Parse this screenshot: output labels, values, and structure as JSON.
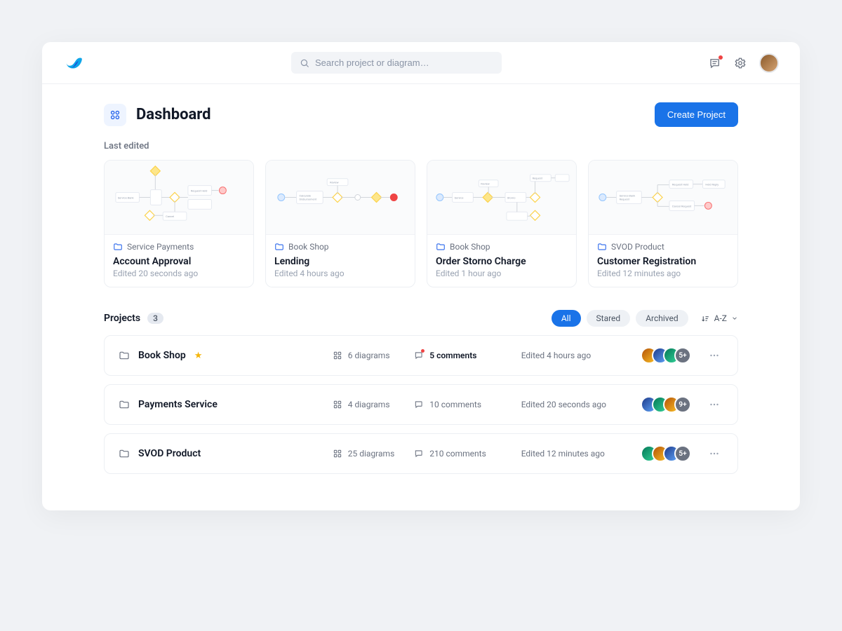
{
  "header": {
    "search_placeholder": "Search project or diagram…"
  },
  "page": {
    "title": "Dashboard",
    "create_button": "Create Project",
    "last_edited_label": "Last edited"
  },
  "last_edited": [
    {
      "folder": "Service Payments",
      "title": "Account Approval",
      "edited": "Edited 20 seconds ago"
    },
    {
      "folder": "Book Shop",
      "title": "Lending",
      "edited": "Edited 4 hours ago"
    },
    {
      "folder": "Book Shop",
      "title": "Order Storno Charge",
      "edited": "Edited 1 hour ago"
    },
    {
      "folder": "SVOD Product",
      "title": "Customer Registration",
      "edited": "Edited 12 minutes ago"
    }
  ],
  "projects_section": {
    "title": "Projects",
    "count": "3",
    "filters": {
      "all": "All",
      "stared": "Stared",
      "archived": "Archived"
    },
    "sort_label": "A-Z"
  },
  "projects": [
    {
      "name": "Book Shop",
      "starred": true,
      "diagrams": "6 diagrams",
      "comments": "5 comments",
      "comments_unread": true,
      "edited": "Edited 4 hours ago",
      "more": "5+"
    },
    {
      "name": "Payments Service",
      "starred": false,
      "diagrams": "4 diagrams",
      "comments": "10 comments",
      "comments_unread": false,
      "edited": "Edited 20 seconds ago",
      "more": "9+"
    },
    {
      "name": "SVOD Product",
      "starred": false,
      "diagrams": "25 diagrams",
      "comments": "210 comments",
      "comments_unread": false,
      "edited": "Edited 12 minutes ago",
      "more": "5+"
    }
  ]
}
